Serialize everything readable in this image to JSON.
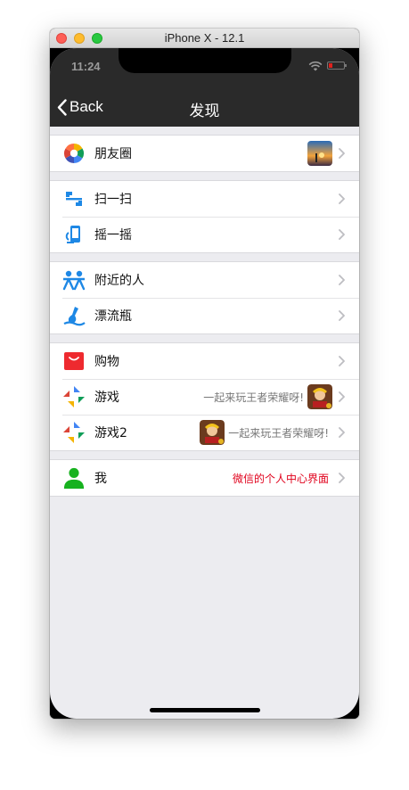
{
  "window": {
    "title": "iPhone X - 12.1"
  },
  "status_bar": {
    "time": "11:24"
  },
  "nav": {
    "back_label": "Back",
    "title": "发现"
  },
  "groups": [
    {
      "rows": [
        {
          "label": "朋友圈",
          "icon": "moments-icon",
          "thumbnail": "sunset-photo-thumbnail"
        }
      ]
    },
    {
      "rows": [
        {
          "label": "扫一扫",
          "icon": "scan-icon"
        },
        {
          "label": "摇一摇",
          "icon": "shake-icon"
        }
      ]
    },
    {
      "rows": [
        {
          "label": "附近的人",
          "icon": "people-nearby-icon"
        },
        {
          "label": "漂流瓶",
          "icon": "drift-bottle-icon"
        }
      ]
    },
    {
      "rows": [
        {
          "label": "购物",
          "icon": "shopping-bag-icon"
        },
        {
          "label": "游戏",
          "icon": "games-icon",
          "detail": "一起来玩王者荣耀呀!",
          "thumbnail": "game-avatar"
        },
        {
          "label": "游戏2",
          "icon": "games-icon",
          "detail": "一起来玩王者荣耀呀!",
          "thumbnail": "game-avatar"
        }
      ]
    },
    {
      "rows": [
        {
          "label": "我",
          "icon": "user-icon",
          "detail": "微信的个人中心界面",
          "detail_color": "#e0001b"
        }
      ]
    }
  ],
  "colors": {
    "nav_background": "#2a2a2a",
    "page_background": "#ececf0",
    "accent_red": "#e0001b"
  }
}
